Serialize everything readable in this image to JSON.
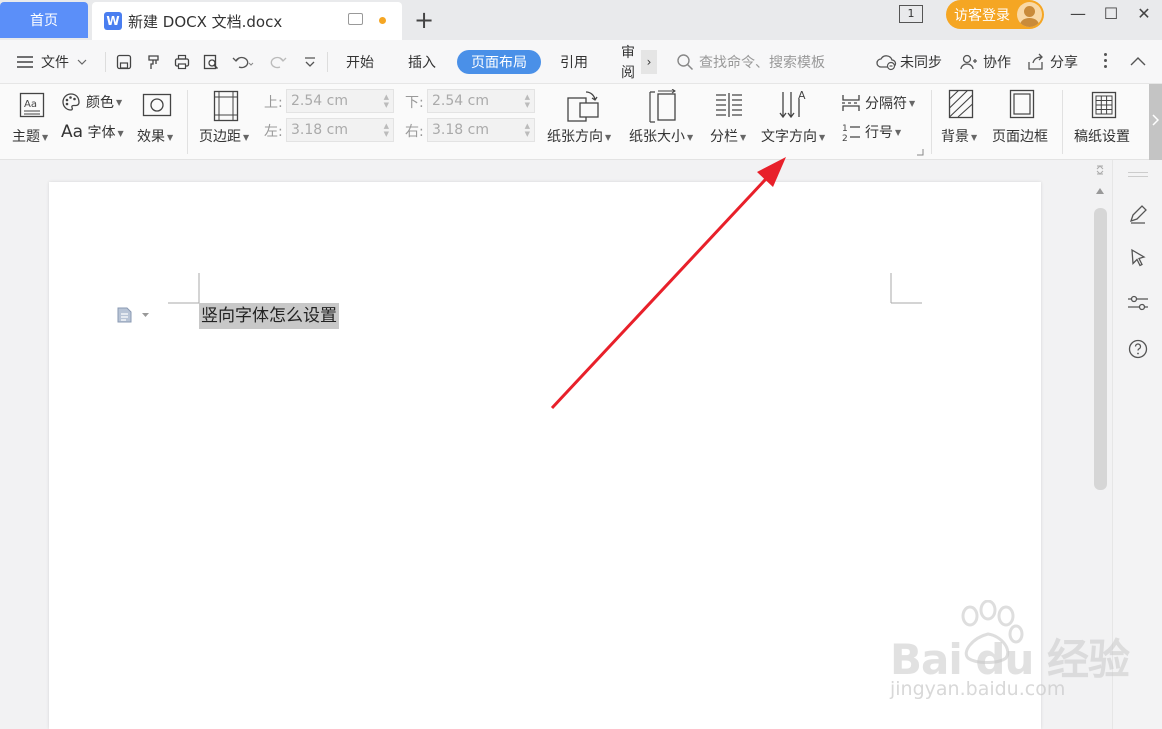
{
  "titlebar": {
    "home_tab": "首页",
    "doc_tab": "新建 DOCX 文档.docx",
    "doc_tab_logo": "W",
    "new_tab": "+",
    "window_badge": "1",
    "login_label": "访客登录",
    "minimize": "—",
    "maximize": "☐",
    "close": "✕"
  },
  "menubar": {
    "file_label": "文件",
    "tabs": [
      "开始",
      "插入",
      "页面布局",
      "引用",
      "审阅"
    ],
    "active_tab": "页面布局",
    "more_tabs": "›",
    "search_placeholder": "查找命令、搜索模板",
    "sync_label": "未同步",
    "collab_label": "协作",
    "share_label": "分享"
  },
  "ribbon": {
    "theme_label": "主题",
    "color_label": "颜色",
    "font_label": "字体",
    "font_prefix": "Aa",
    "effect_label": "效果",
    "margin_label": "页边距",
    "margins": {
      "top_label": "上:",
      "top_value": "2.54 cm",
      "bottom_label": "下:",
      "bottom_value": "2.54 cm",
      "left_label": "左:",
      "left_value": "3.18 cm",
      "right_label": "右:",
      "right_value": "3.18 cm"
    },
    "orientation_label": "纸张方向",
    "size_label": "纸张大小",
    "columns_label": "分栏",
    "text_direction_label": "文字方向",
    "separator_label": "分隔符",
    "line_number_label": "行号",
    "background_label": "背景",
    "page_border_label": "页面边框",
    "grid_paper_label": "稿纸设置"
  },
  "document": {
    "text": "竖向字体怎么设置"
  },
  "watermark": {
    "brand": "Bai du 经验",
    "url": "jingyan.baidu.com"
  },
  "colors": {
    "accent": "#4a90e8",
    "home_tab": "#5b8ff9",
    "login": "#f5a623",
    "arrow": "#e8202a"
  }
}
